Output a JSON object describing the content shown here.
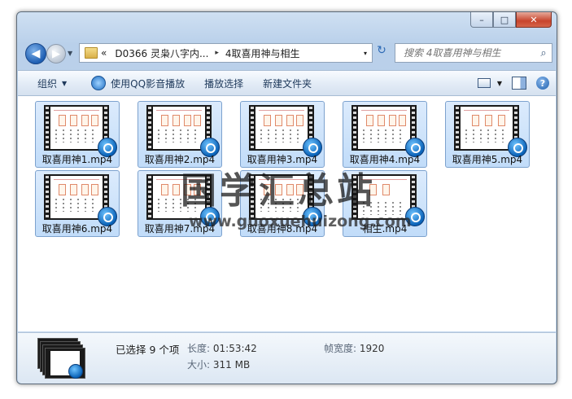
{
  "window": {
    "caption": {
      "minimize": "–",
      "maximize": "□",
      "close": "✕"
    }
  },
  "nav": {
    "back_glyph": "◀",
    "forward_glyph": "▶",
    "address": {
      "overflow": "«",
      "segment1": "D0366 灵枭八字内...",
      "separator": "▸",
      "segment2": "4取喜用神与相生",
      "dropdown": "▾"
    },
    "refresh_glyph": "↻",
    "search_placeholder": "搜索 4取喜用神与相生",
    "search_glyph": "⌕"
  },
  "toolbar": {
    "organize": "组织",
    "play_with_qq": "使用QQ影音播放",
    "play_selected": "播放选择",
    "new_folder": "新建文件夹",
    "help": "?"
  },
  "files": [
    {
      "name": "取喜用神1.mp4"
    },
    {
      "name": "取喜用神2.mp4"
    },
    {
      "name": "取喜用神3.mp4"
    },
    {
      "name": "取喜用神4.mp4"
    },
    {
      "name": "取喜用神5.mp4"
    },
    {
      "name": "取喜用神6.mp4"
    },
    {
      "name": "取喜用神7.mp4"
    },
    {
      "name": "取喜用神8.mp4"
    },
    {
      "name": "相生.mp4"
    }
  ],
  "watermark": {
    "cn": "国学汇总站",
    "url": "www.guoxuehuizong.com"
  },
  "details": {
    "selected": "已选择 9 个项",
    "length_label": "长度:",
    "length_value": "01:53:42",
    "size_label": "大小:",
    "size_value": "311 MB",
    "frame_width_label": "帧宽度:",
    "frame_width_value": "1920"
  },
  "colors": {
    "selection_fill": "#c9e0fa",
    "selection_border": "#7da2ce",
    "accent": "#1f5fb3"
  }
}
